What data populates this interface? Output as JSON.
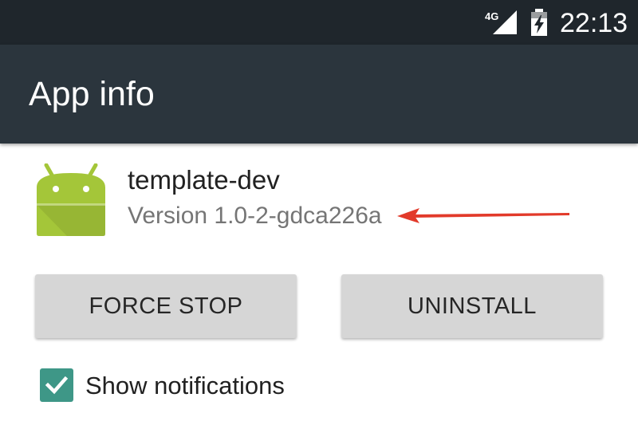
{
  "status_bar": {
    "network_type": "4G",
    "time": "22:13",
    "icons": [
      "signal-icon",
      "battery-charging-icon"
    ]
  },
  "action_bar": {
    "title": "App info"
  },
  "app": {
    "name": "template-dev",
    "version": "Version 1.0-2-gdca226a",
    "icon": "android-app-icon"
  },
  "buttons": {
    "force_stop": "FORCE STOP",
    "uninstall": "UNINSTALL"
  },
  "notifications": {
    "label": "Show notifications",
    "checked": true
  },
  "colors": {
    "status_bar": "#1f262c",
    "action_bar": "#2b353d",
    "android_green": "#a4c639",
    "checkbox_accent": "#3e9787",
    "annotation_arrow": "#e23a2a"
  }
}
